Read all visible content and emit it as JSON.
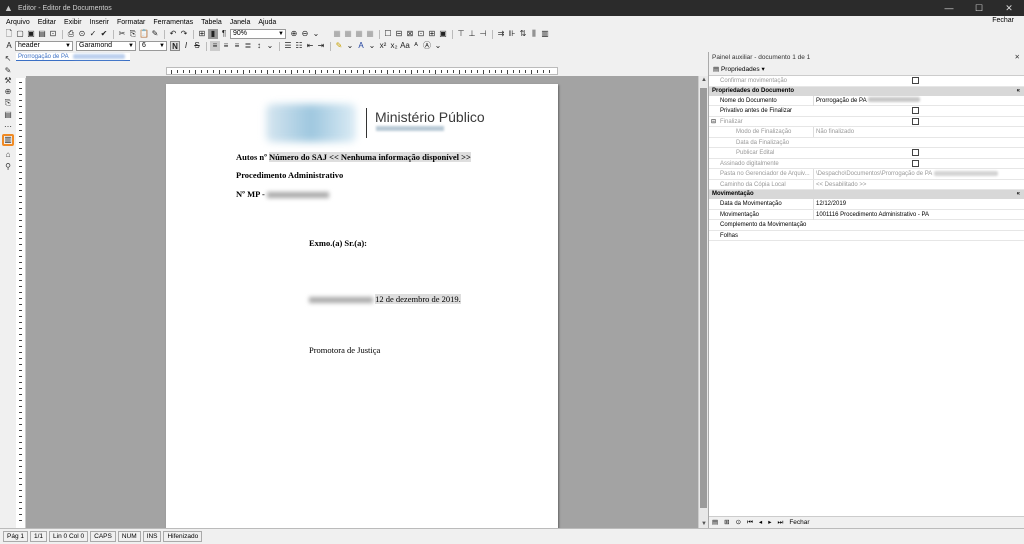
{
  "window": {
    "title": "Editor - Editor de Documentos",
    "close_label": "✕",
    "minimize_label": "—",
    "maximize_label": "☐"
  },
  "menu": {
    "items": [
      "Arquivo",
      "Editar",
      "Exibir",
      "Inserir",
      "Formatar",
      "Ferramentas",
      "Tabela",
      "Janela",
      "Ajuda"
    ],
    "right": "Fechar"
  },
  "toolbar": {
    "zoom": "90%",
    "style": "header",
    "font": "Garamond",
    "size": "6",
    "bold": "N",
    "italic": "I",
    "strike": "S"
  },
  "doc_tab": {
    "label": "Prorrogação de PA"
  },
  "document": {
    "org_name": "Ministério Público",
    "autos_prefix": "Autos nº",
    "autos_field": "Número do SAJ << Nenhuma informação disponível >>",
    "proc": "Procedimento Administrativo",
    "mp_label": "Nº MP -",
    "greeting": "Exmo.(a) Sr.(a):",
    "date": "12 de dezembro de 2019.",
    "signature": "Promotora de Justiça"
  },
  "panel": {
    "title": "Painel auxiliar - documento 1 de 1",
    "close": "✕",
    "tool_label": "Propriedades",
    "rows_top": [
      {
        "label": "Confirmar movimentação",
        "value": "",
        "checkbox": true,
        "gray": true
      }
    ],
    "section_doc": "Propriedades do Documento",
    "doc_rows": [
      {
        "label": "Nome do Documento",
        "value": "Prorrogação de PA",
        "checkbox": false,
        "gray": false,
        "indent": false
      },
      {
        "label": "Privativo antes de Finalizar",
        "value": "",
        "checkbox": true,
        "gray": false,
        "indent": false
      },
      {
        "label": "Finalizar",
        "value": "",
        "checkbox": true,
        "gray": true,
        "indent": false,
        "expander": "⊟"
      },
      {
        "label": "Modo de Finalização",
        "value": "Não finalizado",
        "checkbox": false,
        "gray": true,
        "indent": true
      },
      {
        "label": "Data da Finalização",
        "value": "",
        "checkbox": false,
        "gray": true,
        "indent": true
      },
      {
        "label": "Publicar Edital",
        "value": "",
        "checkbox": true,
        "gray": true,
        "indent": true
      },
      {
        "label": "Assinado digitalmente",
        "value": "",
        "checkbox": true,
        "gray": true,
        "indent": false
      },
      {
        "label": "Pasta no Gerenciador de Arquiv...",
        "value": "\\Despacho\\Documentos\\Prorrogação de PA",
        "checkbox": false,
        "gray": true,
        "indent": false
      },
      {
        "label": "Caminho da Cópia Local",
        "value": "<< Desabilitado >>",
        "checkbox": false,
        "gray": true,
        "indent": false
      }
    ],
    "section_mov": "Movimentação",
    "mov_rows": [
      {
        "label": "Data da Movimentação",
        "value": "12/12/2019"
      },
      {
        "label": "Movimentação",
        "value": "1001116     Procedimento Administrativo - PA"
      },
      {
        "label": "Complemento da Movimentação",
        "value": ""
      },
      {
        "label": "Folhas",
        "value": ""
      }
    ],
    "footer_close": "Fechar"
  },
  "status": {
    "cells": [
      "Pág 1",
      "1/1",
      "Lin 0  Col 0",
      "CAPS",
      "NUM",
      "INS",
      "Hifenizado"
    ]
  }
}
